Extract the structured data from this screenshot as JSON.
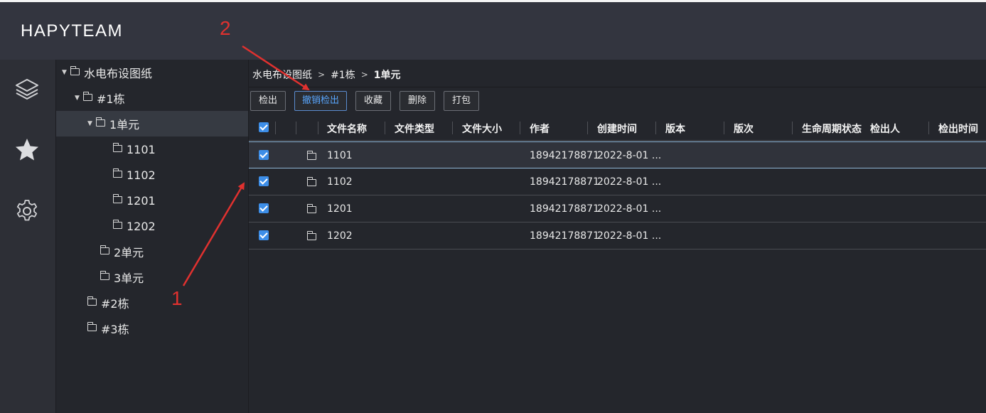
{
  "app": {
    "title": "HAPYTEAM"
  },
  "nav": {
    "items": [
      {
        "icon": "layers-icon"
      },
      {
        "icon": "star-icon"
      },
      {
        "icon": "gear-icon"
      }
    ]
  },
  "tree": {
    "nodes": [
      {
        "label": "水电布设图纸",
        "expanded": true
      },
      {
        "label": "#1栋",
        "expanded": true
      },
      {
        "label": "1单元",
        "expanded": true,
        "active": true
      },
      {
        "label": "1101"
      },
      {
        "label": "1102"
      },
      {
        "label": "1201"
      },
      {
        "label": "1202"
      },
      {
        "label": "2单元"
      },
      {
        "label": "3单元"
      },
      {
        "label": "#2栋"
      },
      {
        "label": "#3栋"
      }
    ]
  },
  "breadcrumb": {
    "items": [
      "水电布设图纸",
      "#1栋",
      "1单元"
    ]
  },
  "toolbar": {
    "checkout": "检出",
    "undo_checkout": "撤销检出",
    "favorite": "收藏",
    "delete": "删除",
    "pack": "打包"
  },
  "table": {
    "columns": [
      "文件名称",
      "文件类型",
      "文件大小",
      "作者",
      "创建时间",
      "版本",
      "版次",
      "生命周期状态",
      "检出人",
      "检出时间"
    ],
    "rows": [
      {
        "name": "1101",
        "type": "",
        "size": "",
        "author": "18942178871",
        "created": "2022-8-01 ...",
        "checked": true
      },
      {
        "name": "1102",
        "type": "",
        "size": "",
        "author": "18942178871",
        "created": "2022-8-01 ...",
        "checked": true
      },
      {
        "name": "1201",
        "type": "",
        "size": "",
        "author": "18942178871",
        "created": "2022-8-01 ...",
        "checked": true
      },
      {
        "name": "1202",
        "type": "",
        "size": "",
        "author": "18942178871",
        "created": "2022-8-01 ...",
        "checked": true
      }
    ]
  },
  "annotations": {
    "step1": "1",
    "step2": "2",
    "color": "#e0312f"
  },
  "colors": {
    "accent": "#3d8ee8",
    "primary_button_text": "#59a7ff"
  }
}
